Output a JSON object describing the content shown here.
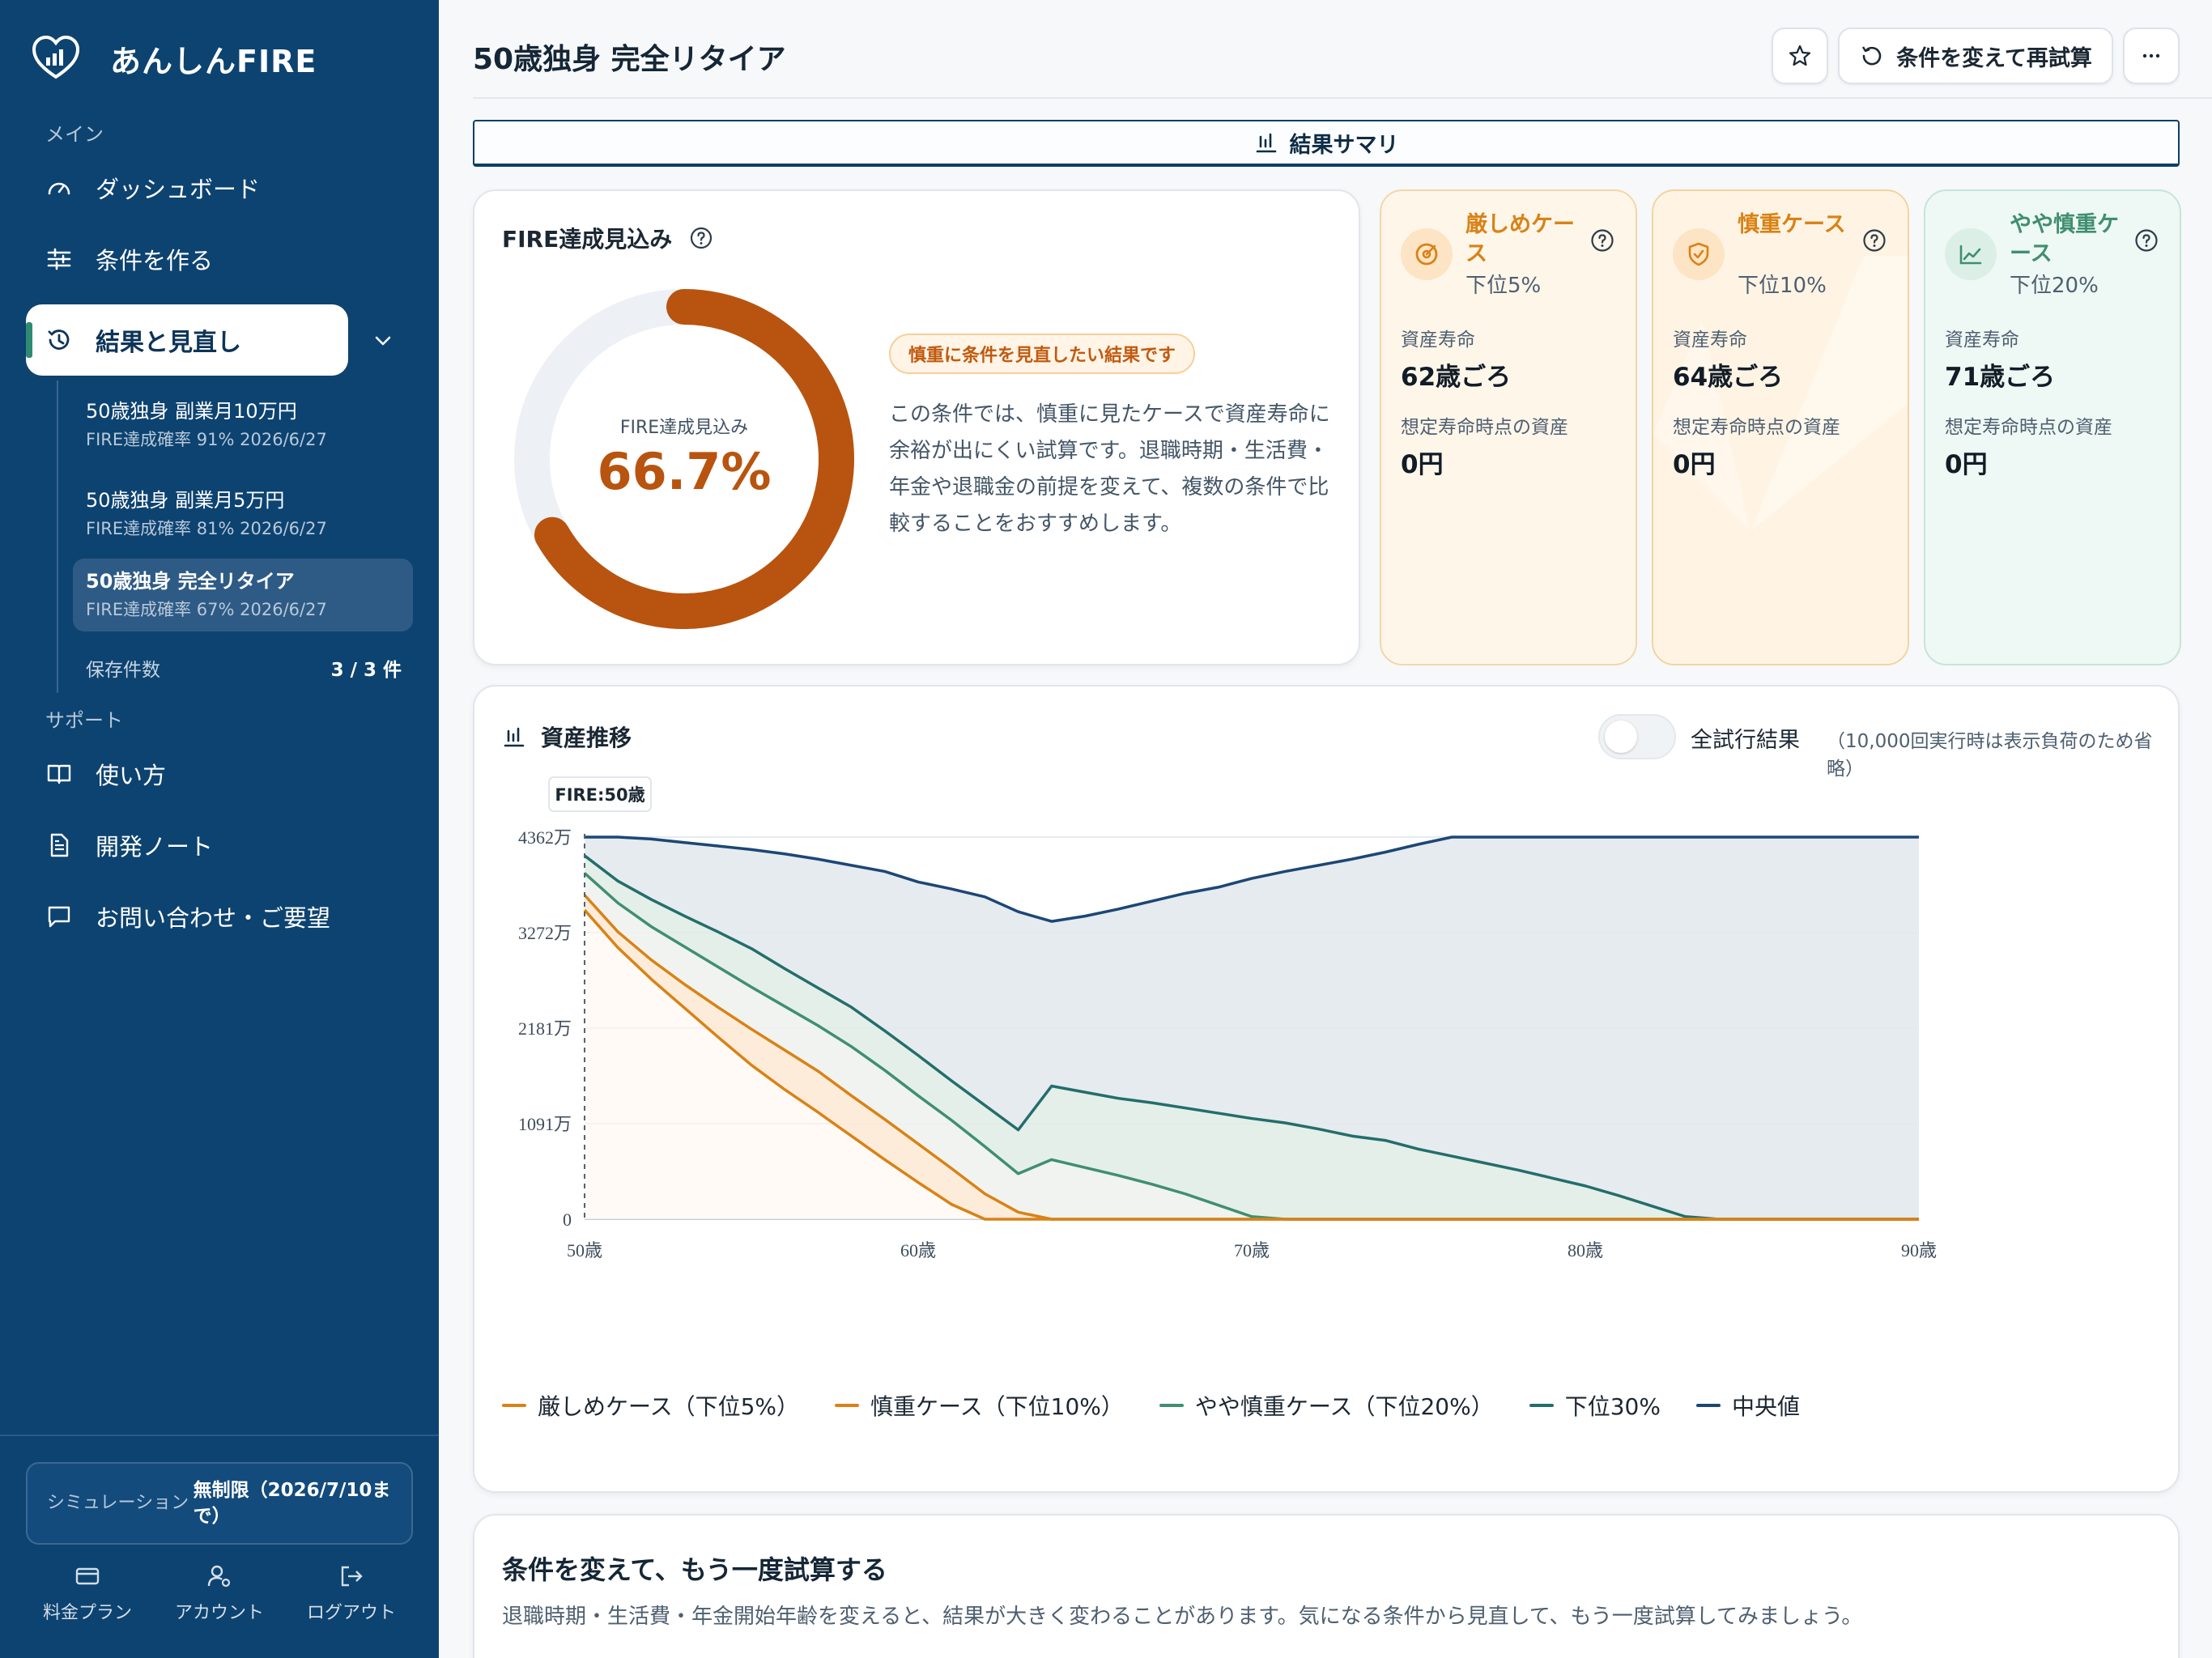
{
  "app": {
    "name": "あんしんFIRE"
  },
  "sidebar": {
    "section_main": "メイン",
    "section_support": "サポート",
    "nav": [
      {
        "label": "ダッシュボード",
        "icon": "gauge-icon"
      },
      {
        "label": "条件を作る",
        "icon": "sliders-icon"
      },
      {
        "label": "結果と見直し",
        "icon": "history-icon"
      }
    ],
    "results": [
      {
        "title": "50歳独身 副業月10万円",
        "meta": "FIRE達成確率 91% 2026/6/27"
      },
      {
        "title": "50歳独身 副業月5万円",
        "meta": "FIRE達成確率 81% 2026/6/27"
      },
      {
        "title": "50歳独身 完全リタイア",
        "meta": "FIRE達成確率 67% 2026/6/27"
      }
    ],
    "saved_label": "保存件数",
    "saved_value": "3 / 3 件",
    "support": [
      {
        "label": "使い方",
        "icon": "book-icon"
      },
      {
        "label": "開発ノート",
        "icon": "document-icon"
      },
      {
        "label": "お問い合わせ・ご要望",
        "icon": "chat-icon"
      }
    ],
    "simulation_label": "シミュレーション",
    "simulation_value": "無制限（2026/7/10まで）",
    "footer": [
      {
        "label": "料金プラン",
        "icon": "card-icon"
      },
      {
        "label": "アカウント",
        "icon": "account-icon"
      },
      {
        "label": "ログアウト",
        "icon": "logout-icon"
      }
    ]
  },
  "header": {
    "title": "50歳独身 完全リタイア",
    "retry_label": "条件を変えて再試算"
  },
  "tabs": {
    "summary": "結果サマリ"
  },
  "fire": {
    "title": "FIRE達成見込み",
    "donut_label": "FIRE達成見込み",
    "value": "66.7%",
    "probability": 0.667,
    "badge": "慎重に条件を見直したい結果です",
    "description": "この条件では、慎重に見たケースで資産寿命に余裕が出にくい試算です。退職時期・生活費・年金や退職金の前提を変えて、複数の条件で比較することをおすすめします。",
    "colors": {
      "accent": "#b8540f",
      "track": "#edf1f5"
    }
  },
  "cases": [
    {
      "name": "厳しめケース",
      "percentile": "下位5%",
      "life_label": "資産寿命",
      "life_value": "62歳ごろ",
      "asset_label": "想定寿命時点の資産",
      "asset_value": "0円",
      "color": "#d98216",
      "icon": "target-icon"
    },
    {
      "name": "慎重ケース",
      "percentile": "下位10%",
      "life_label": "資産寿命",
      "life_value": "64歳ごろ",
      "asset_label": "想定寿命時点の資産",
      "asset_value": "0円",
      "color": "#d98216",
      "icon": "shield-icon"
    },
    {
      "name": "やや慎重ケース",
      "percentile": "下位20%",
      "life_label": "資産寿命",
      "life_value": "71歳ごろ",
      "asset_label": "想定寿命時点の資産",
      "asset_value": "0円",
      "color": "#3f8f70",
      "icon": "trend-icon"
    }
  ],
  "asset_chart": {
    "title": "資産推移",
    "toggle_label": "全試行結果",
    "toggle_on": false,
    "toggle_note": "（10,000回実行時は表示負荷のため省略）",
    "fire_marker": "FIRE:50歳"
  },
  "chart_data": {
    "type": "line",
    "x": [
      50,
      51,
      52,
      53,
      54,
      55,
      56,
      57,
      58,
      59,
      60,
      61,
      62,
      63,
      64,
      65,
      66,
      67,
      68,
      69,
      70,
      71,
      72,
      73,
      74,
      75,
      76,
      77,
      78,
      79,
      80,
      81,
      82,
      83,
      84,
      85,
      86,
      87,
      88,
      89,
      90
    ],
    "x_tick_values": [
      50,
      60,
      70,
      80,
      90
    ],
    "x_tick_labels": [
      "50歳",
      "60歳",
      "70歳",
      "80歳",
      "90歳"
    ],
    "y_ticks": [
      0,
      1091,
      2181,
      3272,
      4362
    ],
    "y_tick_labels": [
      "0",
      "1091万",
      "2181万",
      "3272万",
      "4362万"
    ],
    "ylim": [
      0,
      4362
    ],
    "y_unit": "万円",
    "series": [
      {
        "name": "厳しめケース（下位5%）",
        "color": "#d98216",
        "values": [
          3530,
          3100,
          2740,
          2410,
          2080,
          1760,
          1480,
          1220,
          950,
          680,
          420,
          170,
          0,
          0,
          0,
          0,
          0,
          0,
          0,
          0,
          0,
          0,
          0,
          0,
          0,
          0,
          0,
          0,
          0,
          0,
          0,
          0,
          0,
          0,
          0,
          0,
          0,
          0,
          0,
          0,
          0
        ]
      },
      {
        "name": "慎重ケース（下位10%）",
        "color": "#d98216",
        "values": [
          3700,
          3280,
          2960,
          2680,
          2420,
          2170,
          1930,
          1690,
          1410,
          1140,
          860,
          580,
          290,
          80,
          0,
          0,
          0,
          0,
          0,
          0,
          0,
          0,
          0,
          0,
          0,
          0,
          0,
          0,
          0,
          0,
          0,
          0,
          0,
          0,
          0,
          0,
          0,
          0,
          0,
          0,
          0
        ]
      },
      {
        "name": "やや慎重ケース（下位20%）",
        "color": "#3f8f70",
        "values": [
          3950,
          3610,
          3340,
          3110,
          2880,
          2650,
          2430,
          2210,
          1970,
          1700,
          1410,
          1130,
          830,
          520,
          680,
          590,
          500,
          400,
          290,
          160,
          30,
          0,
          0,
          0,
          0,
          0,
          0,
          0,
          0,
          0,
          0,
          0,
          0,
          0,
          0,
          0,
          0,
          0,
          0,
          0,
          0
        ]
      },
      {
        "name": "下位30%",
        "color": "#236e6a",
        "values": [
          4150,
          3860,
          3650,
          3460,
          3280,
          3090,
          2860,
          2640,
          2420,
          2150,
          1870,
          1580,
          1300,
          1020,
          1520,
          1450,
          1380,
          1330,
          1270,
          1210,
          1150,
          1100,
          1030,
          950,
          900,
          800,
          720,
          640,
          560,
          470,
          380,
          270,
          150,
          30,
          0,
          0,
          0,
          0,
          0,
          0,
          0
        ]
      },
      {
        "name": "中央値",
        "color": "#1c4775",
        "values": [
          4362,
          4362,
          4340,
          4300,
          4260,
          4220,
          4170,
          4110,
          4040,
          3970,
          3850,
          3770,
          3680,
          3510,
          3400,
          3460,
          3540,
          3630,
          3720,
          3790,
          3890,
          3970,
          4040,
          4110,
          4190,
          4280,
          4362,
          4362,
          4362,
          4362,
          4362,
          4362,
          4362,
          4362,
          4362,
          4362,
          4362,
          4362,
          4362,
          4362,
          4362
        ]
      }
    ],
    "fire_age": 50,
    "legend_position": "bottom-left",
    "grid": true
  },
  "retry_section": {
    "title": "条件を変えて、もう一度試算する",
    "description": "退職時期・生活費・年金開始年齢を変えると、結果が大きく変わることがあります。気になる条件から見直して、もう一度試算してみましょう。"
  }
}
